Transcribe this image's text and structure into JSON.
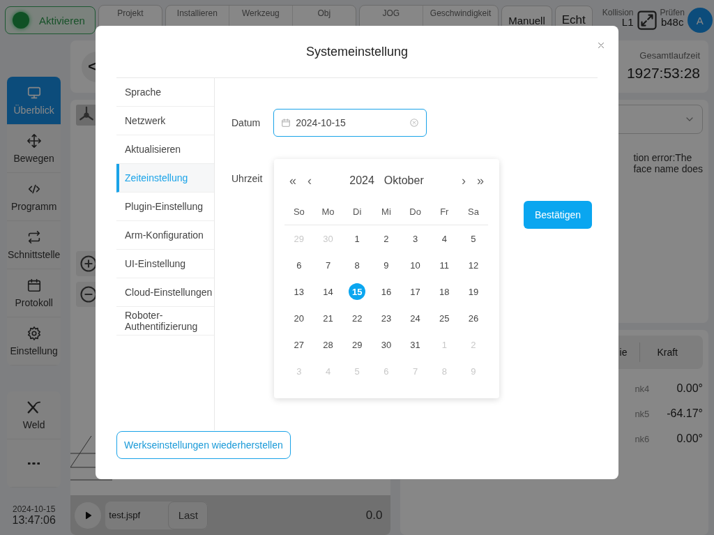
{
  "top_bar": {
    "activate_button": "Aktivieren",
    "groups": [
      [
        {
          "label": "Projekt"
        }
      ],
      [
        {
          "label": "Installieren"
        },
        {
          "label": "Werkzeug"
        },
        {
          "label": "Obj"
        }
      ],
      [
        {
          "label": "JOG"
        },
        {
          "label": "Geschwindigkeit"
        }
      ]
    ],
    "mode_buttons": [
      "Manuell",
      "Echt"
    ],
    "collision": {
      "label": "Kollision",
      "value": "L1"
    },
    "check": {
      "label": "Prüfen",
      "value": "b48c"
    },
    "avatar": "A"
  },
  "sidebar": {
    "items": [
      {
        "label": "Überblick",
        "kind": "monitor",
        "selected": true
      },
      {
        "label": "Bewegen",
        "kind": "move",
        "selected": false
      },
      {
        "label": "Programm",
        "kind": "code",
        "selected": false
      },
      {
        "label": "Schnittstelle",
        "kind": "swap",
        "selected": false
      },
      {
        "label": "Protokoll",
        "kind": "calendar",
        "selected": false
      },
      {
        "label": "Einstellung",
        "kind": "gear",
        "selected": false
      }
    ],
    "extras": [
      {
        "label": "Weld",
        "kind": "weld"
      },
      {
        "kind": "more"
      }
    ]
  },
  "clock": {
    "date": "2024-10-15",
    "time": "13:47:06"
  },
  "view": {
    "back_button": "<"
  },
  "program_bar": {
    "file": "test.jspf",
    "load_button": "Last",
    "value": "0.0"
  },
  "status": {
    "runtime_label": "Gesamtlaufzeit",
    "runtime": "1927:53:28",
    "error_lines": [
      "tion error:The",
      "face name does"
    ],
    "tabs": [
      "ie",
      "Kraft"
    ],
    "joints": [
      {
        "name": "nk4",
        "value": "0.00°"
      },
      {
        "name": "nk5",
        "value": "-64.17°"
      },
      {
        "name": "nk6",
        "value": "0.00°"
      }
    ]
  },
  "dialog": {
    "title": "Systemeinstellung",
    "menu": [
      {
        "label": "Sprache",
        "selected": false
      },
      {
        "label": "Netzwerk",
        "selected": false
      },
      {
        "label": "Aktualisieren",
        "selected": false
      },
      {
        "label": "Zeiteinstellung",
        "selected": true
      },
      {
        "label": "Plugin-Einstellung",
        "selected": false
      },
      {
        "label": "Arm-Konfiguration",
        "selected": false
      },
      {
        "label": "UI-Einstellung",
        "selected": false
      },
      {
        "label": "Cloud-Einstellungen",
        "selected": false
      },
      {
        "label": "Roboter-Authentifizierung",
        "selected": false
      }
    ],
    "date_label": "Datum",
    "date_value": "2024-10-15",
    "time_label": "Uhrzeit",
    "confirm_button": "Bestätigen",
    "reset_button": "Werkseinstellungen wiederherstellen",
    "calendar": {
      "year": "2024",
      "month": "Oktober",
      "nav": {
        "prev_year": "«",
        "prev_month": "‹",
        "next_month": "›",
        "next_year": "»"
      },
      "weekdays": [
        "So",
        "Mo",
        "Di",
        "Mi",
        "Do",
        "Fr",
        "Sa"
      ],
      "days": [
        {
          "text": "29",
          "in_month": false,
          "selected": false
        },
        {
          "text": "30",
          "in_month": false,
          "selected": false
        },
        {
          "text": "1",
          "in_month": true,
          "selected": false
        },
        {
          "text": "2",
          "in_month": true,
          "selected": false
        },
        {
          "text": "3",
          "in_month": true,
          "selected": false
        },
        {
          "text": "4",
          "in_month": true,
          "selected": false
        },
        {
          "text": "5",
          "in_month": true,
          "selected": false
        },
        {
          "text": "6",
          "in_month": true,
          "selected": false
        },
        {
          "text": "7",
          "in_month": true,
          "selected": false
        },
        {
          "text": "8",
          "in_month": true,
          "selected": false
        },
        {
          "text": "9",
          "in_month": true,
          "selected": false
        },
        {
          "text": "10",
          "in_month": true,
          "selected": false
        },
        {
          "text": "11",
          "in_month": true,
          "selected": false
        },
        {
          "text": "12",
          "in_month": true,
          "selected": false
        },
        {
          "text": "13",
          "in_month": true,
          "selected": false
        },
        {
          "text": "14",
          "in_month": true,
          "selected": false
        },
        {
          "text": "15",
          "in_month": true,
          "selected": true
        },
        {
          "text": "16",
          "in_month": true,
          "selected": false
        },
        {
          "text": "17",
          "in_month": true,
          "selected": false
        },
        {
          "text": "18",
          "in_month": true,
          "selected": false
        },
        {
          "text": "19",
          "in_month": true,
          "selected": false
        },
        {
          "text": "20",
          "in_month": true,
          "selected": false
        },
        {
          "text": "21",
          "in_month": true,
          "selected": false
        },
        {
          "text": "22",
          "in_month": true,
          "selected": false
        },
        {
          "text": "23",
          "in_month": true,
          "selected": false
        },
        {
          "text": "24",
          "in_month": true,
          "selected": false
        },
        {
          "text": "25",
          "in_month": true,
          "selected": false
        },
        {
          "text": "26",
          "in_month": true,
          "selected": false
        },
        {
          "text": "27",
          "in_month": true,
          "selected": false
        },
        {
          "text": "28",
          "in_month": true,
          "selected": false
        },
        {
          "text": "29",
          "in_month": true,
          "selected": false
        },
        {
          "text": "30",
          "in_month": true,
          "selected": false
        },
        {
          "text": "31",
          "in_month": true,
          "selected": false
        },
        {
          "text": "1",
          "in_month": false,
          "selected": false
        },
        {
          "text": "2",
          "in_month": false,
          "selected": false
        },
        {
          "text": "3",
          "in_month": false,
          "selected": false
        },
        {
          "text": "4",
          "in_month": false,
          "selected": false
        },
        {
          "text": "5",
          "in_month": false,
          "selected": false
        },
        {
          "text": "6",
          "in_month": false,
          "selected": false
        },
        {
          "text": "7",
          "in_month": false,
          "selected": false
        },
        {
          "text": "8",
          "in_month": false,
          "selected": false
        },
        {
          "text": "9",
          "in_month": false,
          "selected": false
        }
      ]
    }
  }
}
